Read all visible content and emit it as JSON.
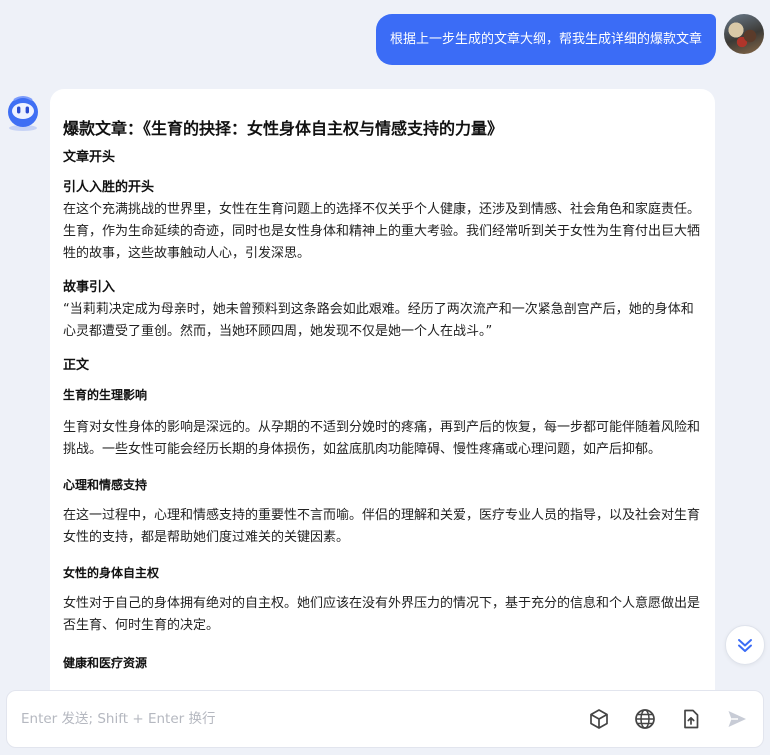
{
  "user_message": "根据上一步生成的文章大纲，帮我生成详细的爆款文章",
  "answer": {
    "title": "爆款文章：《生育的抉择：女性身体自主权与情感支持的力量》",
    "opening_heading": "文章开头",
    "hook_heading": "引人入胜的开头",
    "hook_text": "在这个充满挑战的世界里，女性在生育问题上的选择不仅关乎个人健康，还涉及到情感、社会角色和家庭责任。生育，作为生命延续的奇迹，同时也是女性身体和精神上的重大考验。我们经常听到关于女性为生育付出巨大牺牲的故事，这些故事触动人心，引发深思。",
    "story_heading": "故事引入",
    "story_text": "“当莉莉决定成为母亲时，她未曾预料到这条路会如此艰难。经历了两次流产和一次紧急剖宫产后，她的身体和心灵都遭受了重创。然而，当她环顾四周，她发现不仅是她一个人在战斗。”",
    "body_heading": "正文",
    "sections": [
      {
        "heading": "生育的生理影响",
        "text": "生育对女性身体的影响是深远的。从孕期的不适到分娩时的疼痛，再到产后的恢复，每一步都可能伴随着风险和挑战。一些女性可能会经历长期的身体损伤，如盆底肌肉功能障碍、慢性疼痛或心理问题，如产后抑郁。"
      },
      {
        "heading": "心理和情感支持",
        "text": "在这一过程中，心理和情感支持的重要性不言而喻。伴侣的理解和关爱，医疗专业人员的指导，以及社会对生育女性的支持，都是帮助她们度过难关的关键因素。"
      },
      {
        "heading": "女性的身体自主权",
        "text": "女性对于自己的身体拥有绝对的自主权。她们应该在没有外界压力的情况下，基于充分的信息和个人意愿做出是否生育、何时生育的决定。"
      },
      {
        "heading": "健康和医疗资源",
        "text": ""
      }
    ]
  },
  "input": {
    "placeholder": "Enter 发送; Shift + Enter 换行",
    "value": ""
  },
  "icons": {
    "cube": "cube-icon",
    "globe": "globe-icon",
    "upload": "file-upload-icon",
    "send": "send-icon",
    "scroll": "double-chevron-down-icon",
    "bot": "robot-icon"
  },
  "colors": {
    "accent": "#3b6cf6",
    "background": "#eef1f8"
  }
}
